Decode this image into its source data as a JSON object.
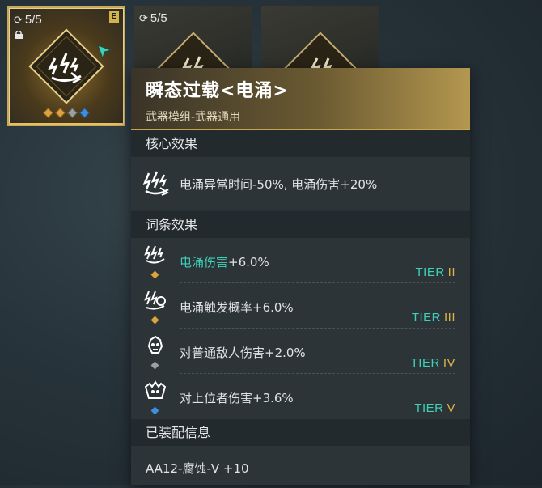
{
  "slots": [
    {
      "count": "5/5",
      "selected": true,
      "tag": "E",
      "locked": true,
      "gems": [
        "gold",
        "gold",
        "gray",
        "blue"
      ]
    },
    {
      "count": "5/5",
      "selected": false
    },
    {
      "count": "",
      "selected": false
    }
  ],
  "panel": {
    "title": "瞬态过载<电涌>",
    "subtitle": "武器模组-武器通用",
    "core_section": "核心效果",
    "core_effect": "电涌异常时间-50%, 电涌伤害+20%",
    "affix_section": "词条效果",
    "affixes": [
      {
        "text_hl": "电涌伤害",
        "text": "+6.0%",
        "tier_word": "TIER",
        "tier_roman": "II",
        "gem": "#e0a23a"
      },
      {
        "text_hl": "",
        "text": "电涌触发概率+6.0%",
        "tier_word": "TIER",
        "tier_roman": "III",
        "gem": "#e0a23a"
      },
      {
        "text_hl": "",
        "text": "对普通敌人伤害+2.0%",
        "tier_word": "TIER",
        "tier_roman": "IV",
        "gem": "#9aa0a0"
      },
      {
        "text_hl": "",
        "text": "对上位者伤害+3.6%",
        "tier_word": "TIER",
        "tier_roman": "V",
        "gem": "#3e8fe0"
      }
    ],
    "equip_section": "已装配信息",
    "equipped_on": "AA12-腐蚀-V +10"
  },
  "colors": {
    "accent_teal": "#3fd0b8",
    "accent_gold": "#d9b44a"
  }
}
